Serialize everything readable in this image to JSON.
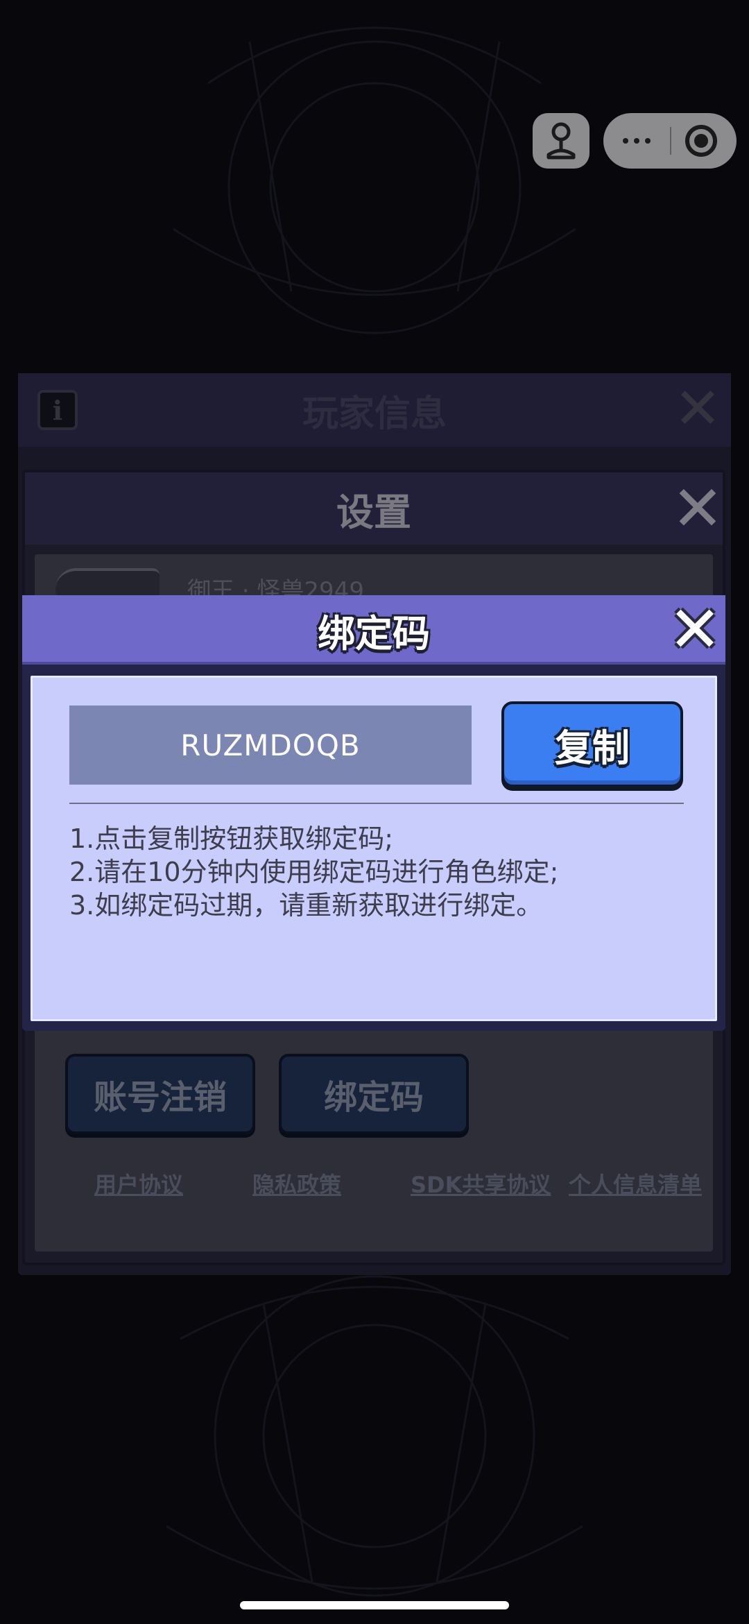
{
  "capsule": {
    "game_icon": "joystick-icon",
    "more_icon": "more-dots-icon",
    "close_icon": "target-close-icon"
  },
  "player_panel": {
    "title": "玩家信息",
    "info_icon_text": "i",
    "close_label": "✕"
  },
  "settings_panel": {
    "title": "设置",
    "close_label": "✕",
    "partial_name": "御王 · 怪兽2949",
    "buttons": [
      "账号注销",
      "绑定码"
    ],
    "links": [
      "用户协议",
      "隐私政策",
      "SDK共享协议",
      "个人信息清单"
    ]
  },
  "bind_dialog": {
    "title": "绑定码",
    "close_label": "✕",
    "code": "RUZMDOQB",
    "copy_label": "复制",
    "instructions": [
      "1.点击复制按钮获取绑定码;",
      "2.请在10分钟内使用绑定码进行角色绑定;",
      "3.如绑定码过期，请重新获取进行绑定。"
    ]
  },
  "colors": {
    "dialog_header": "#6f69ca",
    "dialog_body": "#c9cdfc",
    "copy_button": "#3b7ef2",
    "code_box": "#7b86b3"
  }
}
